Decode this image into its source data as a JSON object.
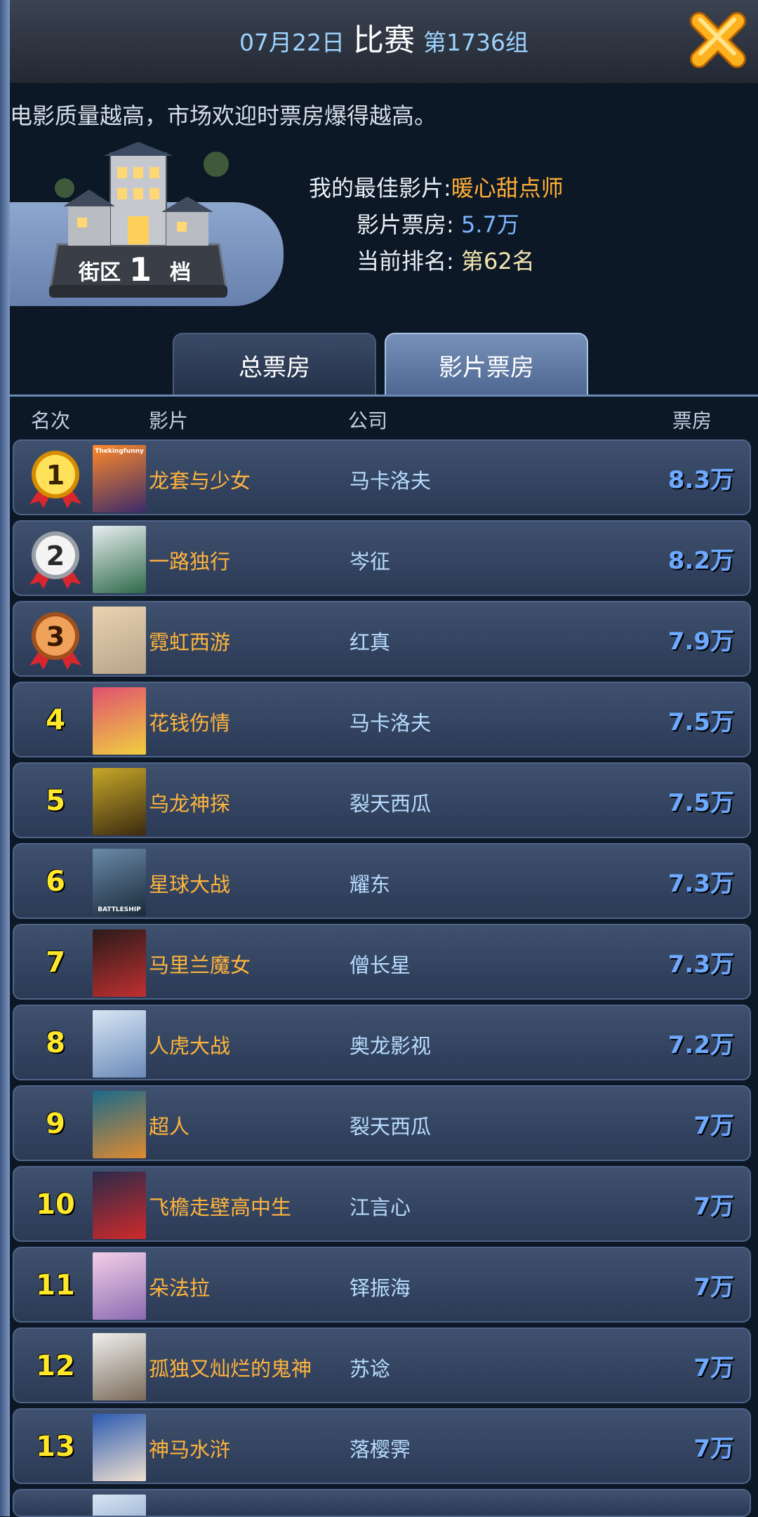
{
  "header": {
    "date": "07月22日",
    "title": "比赛",
    "group": "第1736组"
  },
  "description": "电影质量越高，市场欢迎时票房爆得越高。",
  "district": {
    "label_left": "街区",
    "level": "1",
    "label_right": "档"
  },
  "best": {
    "movie_label": "我的最佳影片:",
    "movie_value": "暖心甜点师",
    "box_label": "影片票房:",
    "box_value": "5.7万",
    "rank_label": "当前排名:",
    "rank_value": "第62名"
  },
  "tabs": [
    {
      "label": "总票房",
      "active": false
    },
    {
      "label": "影片票房",
      "active": true
    }
  ],
  "columns": {
    "rank": "名次",
    "movie": "影片",
    "company": "公司",
    "box": "票房"
  },
  "colors": {
    "movie": "#ffb43d",
    "company": "#b8dcff",
    "box": "#6da9ff",
    "rank": "#ffe72a"
  },
  "rows": [
    {
      "rank": "1",
      "movie": "龙套与少女",
      "company": "马卡洛夫",
      "box": "8.3万",
      "medal": "gold",
      "poster_text": "Thekingfunny"
    },
    {
      "rank": "2",
      "movie": "一路独行",
      "company": "岑征",
      "box": "8.2万",
      "medal": "silver"
    },
    {
      "rank": "3",
      "movie": "霓虹西游",
      "company": "红真",
      "box": "7.9万",
      "medal": "bronze"
    },
    {
      "rank": "4",
      "movie": "花钱伤情",
      "company": "马卡洛夫",
      "box": "7.5万"
    },
    {
      "rank": "5",
      "movie": "乌龙神探",
      "company": "裂天西瓜",
      "box": "7.5万"
    },
    {
      "rank": "6",
      "movie": "星球大战",
      "company": "耀东",
      "box": "7.3万",
      "poster_text": "BATTLESHIP"
    },
    {
      "rank": "7",
      "movie": "马里兰魔女",
      "company": "僧长星",
      "box": "7.3万"
    },
    {
      "rank": "8",
      "movie": "人虎大战",
      "company": "奥龙影视",
      "box": "7.2万"
    },
    {
      "rank": "9",
      "movie": "超人",
      "company": "裂天西瓜",
      "box": "7万"
    },
    {
      "rank": "10",
      "movie": "飞檐走壁高中生",
      "company": "江言心",
      "box": "7万"
    },
    {
      "rank": "11",
      "movie": "朵法拉",
      "company": "铎振海",
      "box": "7万"
    },
    {
      "rank": "12",
      "movie": "孤独又灿烂的鬼神",
      "company": "苏谂",
      "box": "7万"
    },
    {
      "rank": "13",
      "movie": "神马水浒",
      "company": "落樱霁",
      "box": "7万"
    }
  ]
}
